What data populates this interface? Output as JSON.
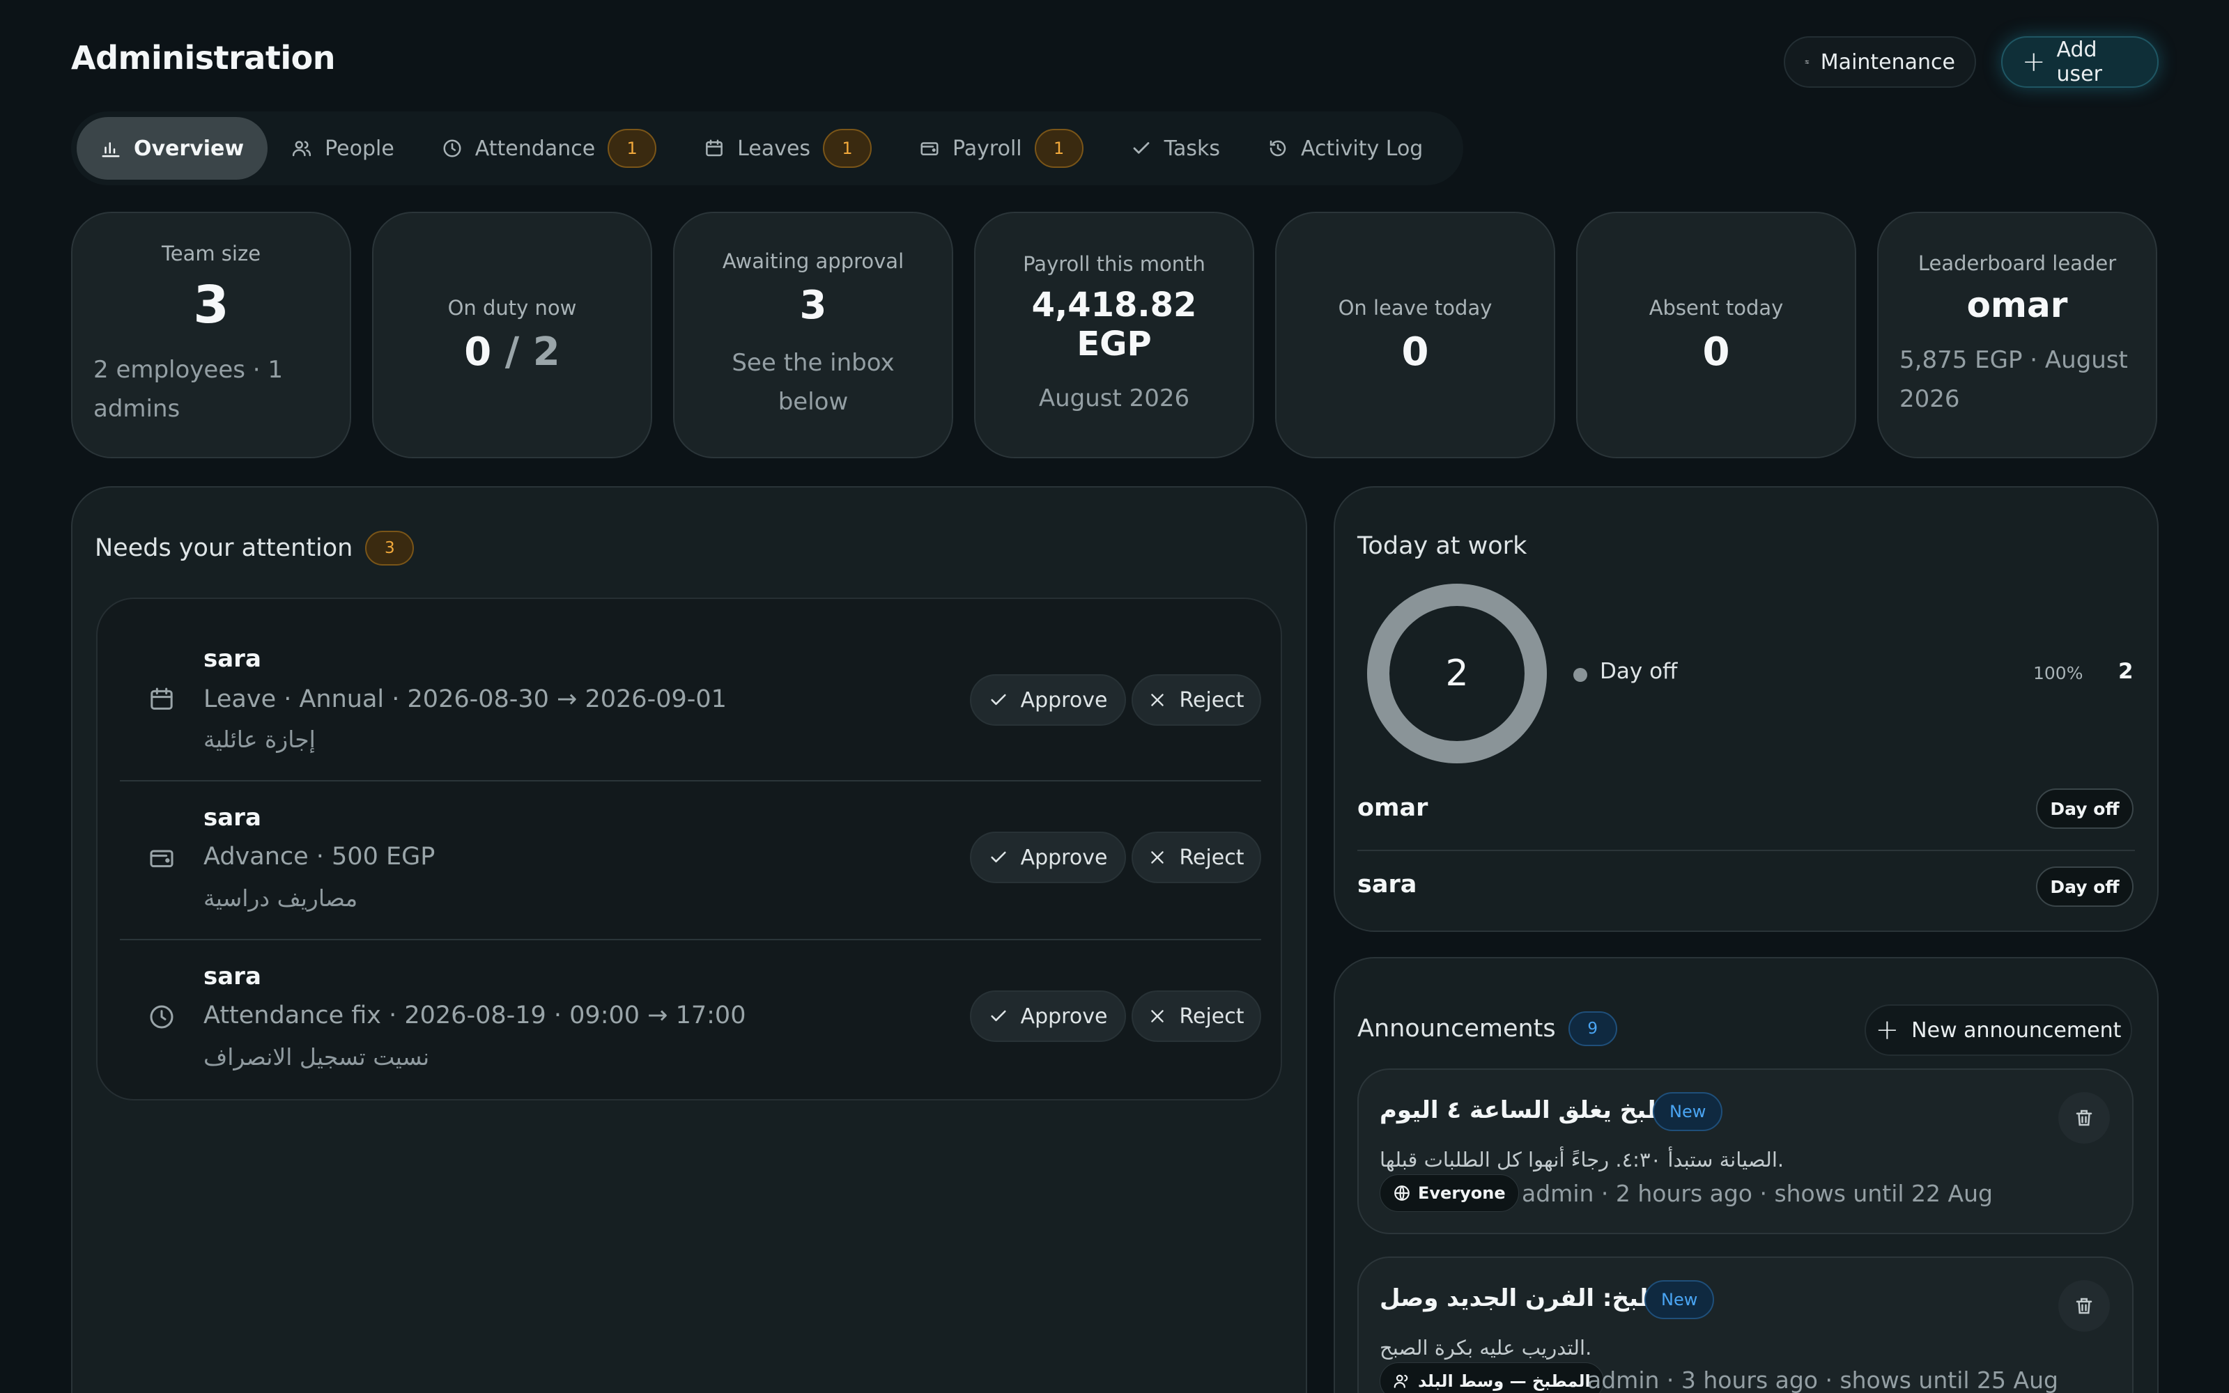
{
  "header": {
    "title": "Administration",
    "maintenance_label": "Maintenance",
    "add_user_label": "Add user"
  },
  "tabs": [
    {
      "label": "Overview",
      "icon": "bar-chart-icon",
      "badge": ""
    },
    {
      "label": "People",
      "icon": "people-icon",
      "badge": ""
    },
    {
      "label": "Attendance",
      "icon": "clock-icon",
      "badge": "1"
    },
    {
      "label": "Leaves",
      "icon": "calendar-icon",
      "badge": "1"
    },
    {
      "label": "Payroll",
      "icon": "wallet-icon",
      "badge": "1"
    },
    {
      "label": "Tasks",
      "icon": "check-icon",
      "badge": ""
    },
    {
      "label": "Activity Log",
      "icon": "history-icon",
      "badge": ""
    }
  ],
  "stats": {
    "team_size": {
      "label": "Team size",
      "value": "3",
      "sub": "2 employees · 1 admins"
    },
    "on_duty": {
      "label": "On duty now",
      "value": "0",
      "total": "/ 2"
    },
    "awaiting": {
      "label": "Awaiting approval",
      "value": "3",
      "sub": "See the inbox below"
    },
    "payroll": {
      "label": "Payroll this month",
      "value": "4,418.82 EGP",
      "sub": "August 2026"
    },
    "on_leave": {
      "label": "On leave today",
      "value": "0"
    },
    "absent": {
      "label": "Absent today",
      "value": "0"
    },
    "leader": {
      "label": "Leaderboard leader",
      "value": "omar",
      "sub": "5,875 EGP · August 2026"
    }
  },
  "attention": {
    "title": "Needs your attention",
    "count": "3",
    "approve_label": "Approve",
    "reject_label": "Reject",
    "items": [
      {
        "name": "sara",
        "detail": "Leave · Annual · 2026-08-30 → 2026-09-01",
        "note": "إجازة عائلية",
        "icon": "calendar-icon"
      },
      {
        "name": "sara",
        "detail": "Advance · 500 EGP",
        "note": "مصاريف دراسية",
        "icon": "wallet-icon"
      },
      {
        "name": "sara",
        "detail": "Attendance fix · 2026-08-19 · 09:00 → 17:00",
        "note": "نسيت تسجيل الانصراف",
        "icon": "clock-icon"
      }
    ]
  },
  "today": {
    "title": "Today at work",
    "donut_total": "2",
    "legend": [
      {
        "label": "Day off",
        "percent": "100%",
        "count": "2",
        "fraction": 1.0,
        "color": "#8a9498"
      }
    ],
    "people": [
      {
        "name": "omar",
        "status": "Day off"
      },
      {
        "name": "sara",
        "status": "Day off"
      }
    ]
  },
  "announcements": {
    "title": "Announcements",
    "count": "9",
    "new_label": "New announcement",
    "items": [
      {
        "title": "المطبخ يغلق الساعة ٤ اليوم",
        "badge": "New",
        "body": "الصيانة ستبدأ ٤:٣٠. رجاءً أنهوا كل الطلبات قبلها.",
        "audience": "Everyone",
        "audience_icon": "globe-icon",
        "meta": "admin · 2 hours ago · shows until 22 Aug"
      },
      {
        "title": "المطبخ: الفرن الجديد وصل",
        "badge": "New",
        "body": "التدريب عليه بكرة الصبح.",
        "audience": "المطبخ — وسط البلد",
        "audience_icon": "people-icon",
        "meta": "admin · 3 hours ago · shows until 25 Aug"
      }
    ]
  },
  "colors": {
    "accent_amber": "#f2a93b",
    "accent_blue": "#4aa5f3",
    "accent_teal": "#28aac8"
  }
}
